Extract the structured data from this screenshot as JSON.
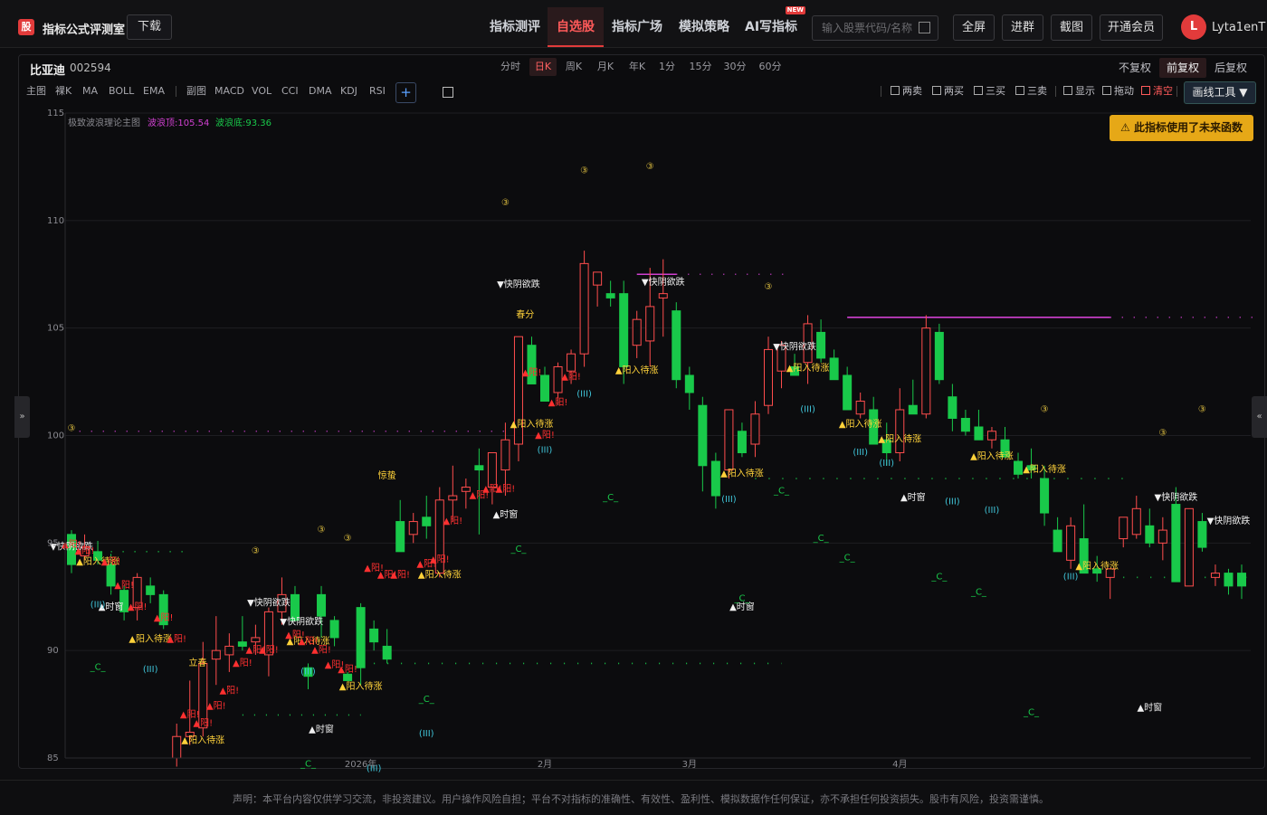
{
  "app": {
    "logo_glyph": "股",
    "title": "指标公式评测室",
    "download": "下载"
  },
  "nav": {
    "items": [
      "指标测评",
      "自选股",
      "指标广场",
      "模拟策略",
      "AI写指标"
    ],
    "active": "自选股",
    "new_badge": "NEW"
  },
  "search": {
    "placeholder": "输入股票代码/名称"
  },
  "top_buttons": {
    "fullscreen": "全屏",
    "join_group": "进群",
    "screenshot": "截图",
    "vip": "开通会员"
  },
  "user": {
    "avatar_letter": "L",
    "name": "Lyta1enT"
  },
  "stock": {
    "name": "比亚迪",
    "code": "002594"
  },
  "periods": [
    "分时",
    "日K",
    "周K",
    "月K",
    "年K",
    "1分",
    "15分",
    "30分",
    "60分"
  ],
  "active_period": "日K",
  "adjust": {
    "options": [
      "不复权",
      "前复权",
      "后复权"
    ],
    "active": "前复权"
  },
  "toolbar": {
    "main_label": "主图",
    "main_items": [
      "裸K",
      "MA",
      "BOLL",
      "EMA"
    ],
    "sub_label": "副图",
    "sub_items": [
      "MACD",
      "VOL",
      "CCI",
      "DMA",
      "KDJ",
      "RSI"
    ],
    "plus": "+"
  },
  "signal_filters": [
    "两卖",
    "两买",
    "三买",
    "三卖",
    "显示",
    "拖动"
  ],
  "clear_label": "清空",
  "draw_tool": "画线工具 ▼",
  "indicator": {
    "name": "极致波浪理论主图",
    "top_label": "波浪顶:105.54",
    "bottom_label": "波浪底:93.36"
  },
  "warning": "⚠ 此指标使用了未来函数",
  "chart_data": {
    "type": "candlestick",
    "ylim": [
      85,
      115
    ],
    "y_ticks": [
      "85",
      "90",
      "95",
      "100",
      "105",
      "110",
      "115"
    ],
    "x_labels": [
      "2026年",
      "2月",
      "3月",
      "4月"
    ],
    "colors": {
      "up": "#ff4d4d",
      "down": "#19c94a",
      "wave_top": "#d040d0",
      "wave_bottom": "#19c94a"
    },
    "wave_top": 105.54,
    "wave_bottom": 93.36,
    "candles": [
      [
        95.4,
        95.6,
        93.6,
        94.0
      ],
      [
        94.4,
        95.4,
        94.2,
        94.8
      ],
      [
        94.6,
        95.1,
        94.0,
        94.2
      ],
      [
        94.0,
        94.5,
        92.6,
        93.0
      ],
      [
        92.8,
        93.0,
        91.4,
        91.8
      ],
      [
        92.0,
        93.6,
        91.4,
        93.4
      ],
      [
        93.0,
        93.4,
        92.2,
        92.6
      ],
      [
        92.6,
        92.8,
        91.0,
        91.2
      ],
      [
        85.0,
        86.6,
        84.6,
        86.0
      ],
      [
        86.0,
        88.6,
        85.6,
        86.2
      ],
      [
        86.4,
        90.4,
        86.0,
        89.4
      ],
      [
        89.6,
        91.6,
        88.4,
        90.0
      ],
      [
        89.8,
        90.8,
        89.0,
        90.2
      ],
      [
        90.4,
        91.6,
        90.0,
        90.2
      ],
      [
        90.4,
        91.2,
        89.8,
        90.6
      ],
      [
        89.8,
        92.0,
        88.8,
        91.8
      ],
      [
        91.8,
        93.4,
        91.2,
        92.6
      ],
      [
        92.6,
        93.0,
        91.4,
        91.4
      ],
      [
        89.2,
        89.4,
        88.2,
        88.8
      ],
      [
        92.6,
        93.0,
        90.6,
        91.6
      ],
      [
        91.4,
        91.6,
        90.2,
        90.6
      ],
      [
        88.9,
        89.0,
        88.6,
        88.6
      ],
      [
        92.0,
        92.2,
        88.4,
        89.2
      ],
      [
        91.0,
        91.4,
        90.0,
        90.4
      ],
      [
        90.2,
        91.0,
        89.4,
        89.6
      ],
      [
        96.0,
        97.0,
        94.6,
        94.6
      ],
      [
        95.4,
        96.4,
        95.0,
        96.0
      ],
      [
        96.2,
        97.2,
        95.2,
        95.8
      ],
      [
        93.6,
        97.6,
        93.4,
        97.0
      ],
      [
        97.0,
        98.6,
        96.0,
        97.2
      ],
      [
        97.4,
        98.0,
        96.6,
        97.6
      ],
      [
        98.6,
        99.4,
        95.4,
        98.4
      ],
      [
        97.6,
        99.2,
        96.8,
        99.2
      ],
      [
        98.4,
        100.6,
        97.2,
        99.8
      ],
      [
        99.6,
        104.4,
        98.8,
        104.6
      ],
      [
        104.2,
        104.6,
        102.8,
        102.4
      ],
      [
        102.8,
        103.2,
        101.8,
        101.6
      ],
      [
        102.0,
        103.4,
        101.4,
        103.2
      ],
      [
        103.0,
        104.0,
        102.4,
        103.8
      ],
      [
        103.8,
        108.6,
        103.2,
        108.0
      ],
      [
        107.0,
        107.6,
        106.0,
        107.6
      ],
      [
        106.6,
        107.2,
        106.0,
        106.4
      ],
      [
        106.6,
        107.2,
        102.4,
        103.2
      ],
      [
        104.2,
        105.8,
        103.6,
        105.4
      ],
      [
        104.4,
        107.8,
        103.2,
        106.0
      ],
      [
        106.4,
        108.2,
        104.6,
        106.6
      ],
      [
        105.8,
        106.2,
        102.2,
        102.6
      ],
      [
        102.8,
        103.2,
        101.2,
        102.0
      ],
      [
        101.4,
        101.8,
        97.4,
        98.6
      ],
      [
        98.8,
        99.2,
        96.6,
        97.2
      ],
      [
        98.4,
        101.0,
        98.0,
        101.2
      ],
      [
        100.2,
        100.6,
        99.0,
        99.2
      ],
      [
        99.6,
        101.6,
        99.0,
        101.0
      ],
      [
        101.4,
        104.6,
        101.0,
        104.0
      ],
      [
        103.0,
        104.4,
        102.2,
        104.2
      ],
      [
        103.2,
        103.8,
        102.8,
        102.8
      ],
      [
        103.4,
        105.6,
        102.4,
        105.2
      ],
      [
        104.8,
        105.4,
        103.4,
        103.6
      ],
      [
        103.6,
        104.0,
        102.6,
        102.6
      ],
      [
        102.8,
        103.2,
        101.2,
        101.2
      ],
      [
        101.0,
        102.0,
        100.8,
        101.6
      ],
      [
        101.2,
        101.8,
        99.6,
        99.6
      ],
      [
        99.8,
        100.6,
        98.6,
        99.2
      ],
      [
        99.2,
        102.2,
        98.8,
        101.2
      ],
      [
        101.4,
        102.6,
        101.0,
        101.0
      ],
      [
        101.0,
        105.6,
        100.8,
        105.0
      ],
      [
        104.8,
        105.2,
        102.4,
        102.6
      ],
      [
        101.8,
        102.4,
        100.2,
        100.8
      ],
      [
        100.8,
        101.2,
        100.0,
        100.2
      ],
      [
        100.4,
        101.2,
        99.8,
        99.8
      ],
      [
        99.8,
        100.4,
        99.4,
        100.2
      ],
      [
        99.8,
        100.4,
        99.0,
        99.0
      ],
      [
        98.8,
        99.2,
        98.0,
        98.2
      ],
      [
        98.6,
        99.4,
        98.0,
        98.4
      ],
      [
        98.0,
        98.6,
        95.8,
        96.4
      ],
      [
        95.6,
        96.2,
        94.6,
        94.6
      ],
      [
        94.2,
        96.2,
        93.8,
        95.8
      ],
      [
        95.2,
        96.8,
        93.8,
        93.6
      ],
      [
        93.8,
        94.4,
        93.2,
        93.6
      ],
      [
        93.4,
        93.8,
        92.4,
        93.8
      ],
      [
        95.2,
        96.2,
        94.8,
        96.2
      ],
      [
        95.4,
        97.2,
        95.2,
        96.6
      ],
      [
        95.8,
        96.6,
        94.8,
        95.0
      ],
      [
        95.0,
        96.2,
        94.2,
        95.6
      ],
      [
        96.8,
        97.6,
        95.2,
        93.2
      ],
      [
        93.0,
        96.2,
        93.0,
        96.6
      ],
      [
        96.0,
        96.4,
        94.6,
        94.8
      ],
      [
        93.4,
        94.0,
        93.0,
        93.6
      ],
      [
        93.6,
        93.8,
        92.6,
        93.0
      ],
      [
        93.6,
        94.0,
        92.4,
        93.0
      ]
    ],
    "labels": {
      "fast_drop": "▼快阴欲跌",
      "wait_rise": "▲阳入待涨",
      "time_window": "▲时窗",
      "yang": "▲阳!",
      "circle3": "③",
      "wave3": "(III)",
      "wave_c": "_C_",
      "spring_equinox": "春分",
      "awakening": "惊蛰",
      "spring_start": "立春"
    }
  },
  "footer": "声明：本平台内容仅供学习交流，非投资建议。用户操作风险自担；平台不对指标的准确性、有效性、盈利性、模拟数据作任何保证，亦不承担任何投资损失。股市有风险，投资需谨慎。"
}
